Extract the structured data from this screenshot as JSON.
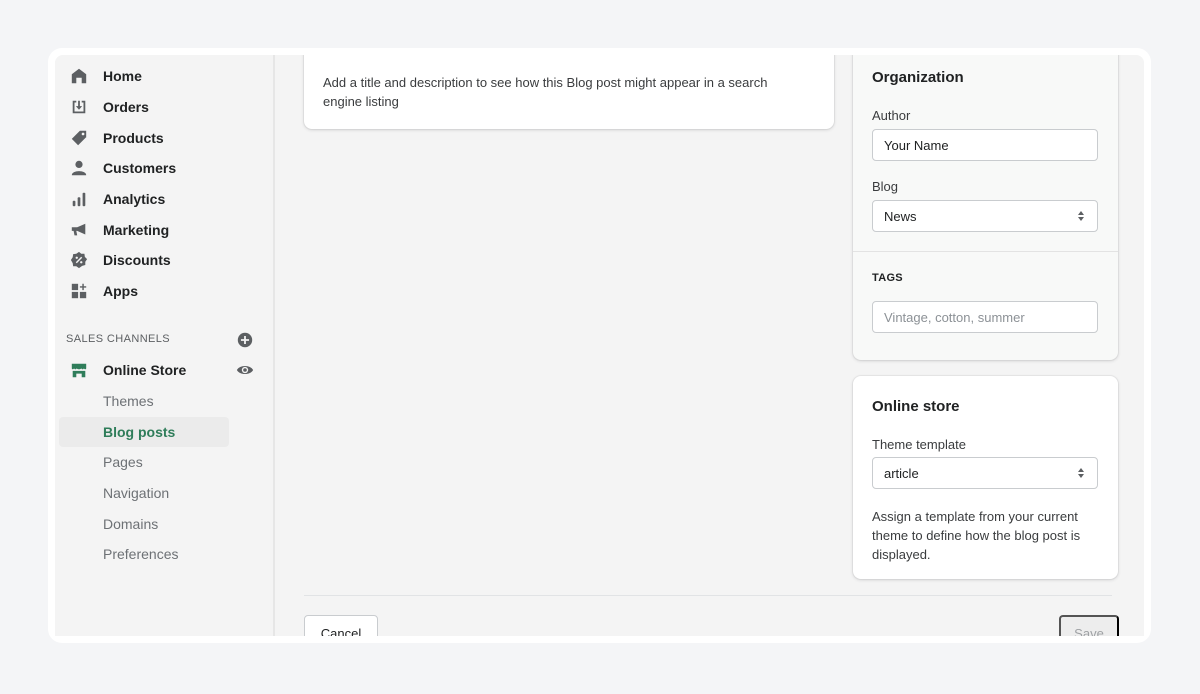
{
  "sidebar": {
    "items": [
      {
        "label": "Home",
        "icon": "home-icon"
      },
      {
        "label": "Orders",
        "icon": "orders-icon"
      },
      {
        "label": "Products",
        "icon": "tag-icon"
      },
      {
        "label": "Customers",
        "icon": "person-icon"
      },
      {
        "label": "Analytics",
        "icon": "bar-chart-icon"
      },
      {
        "label": "Marketing",
        "icon": "megaphone-icon"
      },
      {
        "label": "Discounts",
        "icon": "discount-icon"
      },
      {
        "label": "Apps",
        "icon": "apps-icon"
      }
    ],
    "sales_channels_title": "SALES CHANNELS",
    "channel": {
      "label": "Online Store",
      "icon": "store-icon"
    },
    "sub_items": [
      {
        "label": "Themes",
        "active": false
      },
      {
        "label": "Blog posts",
        "active": true
      },
      {
        "label": "Pages",
        "active": false
      },
      {
        "label": "Navigation",
        "active": false
      },
      {
        "label": "Domains",
        "active": false
      },
      {
        "label": "Preferences",
        "active": false
      }
    ]
  },
  "seo": {
    "preview_text": "Add a title and description to see how this Blog post might appear in a search engine listing"
  },
  "organization": {
    "title": "Organization",
    "author_label": "Author",
    "author_value": "Your Name",
    "blog_label": "Blog",
    "blog_value": "News",
    "tags_label": "TAGS",
    "tags_placeholder": "Vintage, cotton, summer"
  },
  "online_store": {
    "title": "Online store",
    "template_label": "Theme template",
    "template_value": "article",
    "help_text": "Assign a template from your current theme to define how the blog post is displayed."
  },
  "footer": {
    "cancel_label": "Cancel",
    "save_label": "Save"
  },
  "colors": {
    "accent_green": "#2f7d5a",
    "icon_gray": "#5c5f62"
  }
}
